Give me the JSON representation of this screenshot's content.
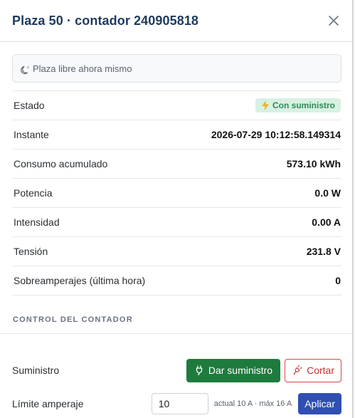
{
  "header": {
    "title": "Plaza 50 · contador 240905818"
  },
  "notice": {
    "text": "Plaza libre ahora mismo"
  },
  "status_rows": [
    {
      "label": "Estado",
      "value": "Con suministro",
      "type": "badge"
    },
    {
      "label": "Instante",
      "value": "2026-07-29 10:12:58.149314"
    },
    {
      "label": "Consumo acumulado",
      "value": "573.10 kWh"
    },
    {
      "label": "Potencia",
      "value": "0.0 W"
    },
    {
      "label": "Intensidad",
      "value": "0.00 A"
    },
    {
      "label": "Tensión",
      "value": "231.8 V"
    },
    {
      "label": "Sobreamperajes (última hora)",
      "value": "0"
    }
  ],
  "control": {
    "section_title": "CONTROL DEL CONTADOR",
    "supply_label": "Suministro",
    "supply_button": "Dar suministro",
    "cut_button": "Cortar",
    "limit_label": "Límite amperaje",
    "limit_value": "10",
    "limit_hint": "actual 10 A · máx 16 A",
    "apply_button": "Aplicar"
  },
  "colors": {
    "title": "#1e3a5f",
    "badge_bg": "#d7f1e3",
    "badge_text": "#2e8b57",
    "supply_button": "#1e7b3d",
    "cut_button": "#c53030",
    "apply_button": "#2f4fb3"
  },
  "icons": {
    "close": "close-icon",
    "notice": "moon-icon",
    "status": "bolt-icon",
    "supply": "plug-icon",
    "cut": "unplug-icon"
  }
}
